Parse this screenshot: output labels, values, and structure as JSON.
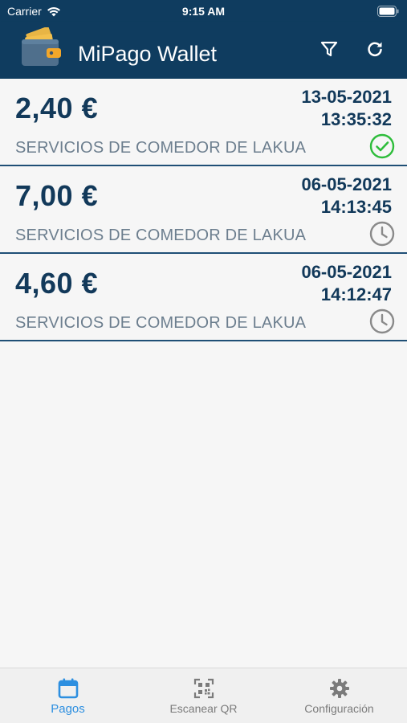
{
  "status_bar": {
    "carrier": "Carrier",
    "time": "9:15 AM"
  },
  "header": {
    "title": "MiPago Wallet",
    "logo_icon": "wallet-icon",
    "actions": [
      {
        "icon": "filter-icon"
      },
      {
        "icon": "refresh-icon"
      }
    ],
    "background_color": "#0f3c5f"
  },
  "payments": [
    {
      "amount": "2,40 €",
      "date": "13-05-2021",
      "time": "13:35:32",
      "merchant": "SERVICIOS DE COMEDOR DE LAKUA",
      "status": "completed",
      "status_icon": "check-circle-icon",
      "status_color": "#2ebd3b"
    },
    {
      "amount": "7,00 €",
      "date": "06-05-2021",
      "time": "14:13:45",
      "merchant": "SERVICIOS DE COMEDOR DE LAKUA",
      "status": "pending",
      "status_icon": "clock-icon",
      "status_color": "#8a8a8a"
    },
    {
      "amount": "4,60 €",
      "date": "06-05-2021",
      "time": "14:12:47",
      "merchant": "SERVICIOS DE COMEDOR DE LAKUA",
      "status": "pending",
      "status_icon": "clock-icon",
      "status_color": "#8a8a8a"
    }
  ],
  "tabs": [
    {
      "label": "Pagos",
      "icon": "calendar-icon",
      "active": true
    },
    {
      "label": "Escanear QR",
      "icon": "qr-code-icon",
      "active": false
    },
    {
      "label": "Configuración",
      "icon": "gear-icon",
      "active": false
    }
  ],
  "colors": {
    "accent": "#2d8fe0",
    "text_dark": "#12395a",
    "text_muted": "#6c7e8e"
  }
}
